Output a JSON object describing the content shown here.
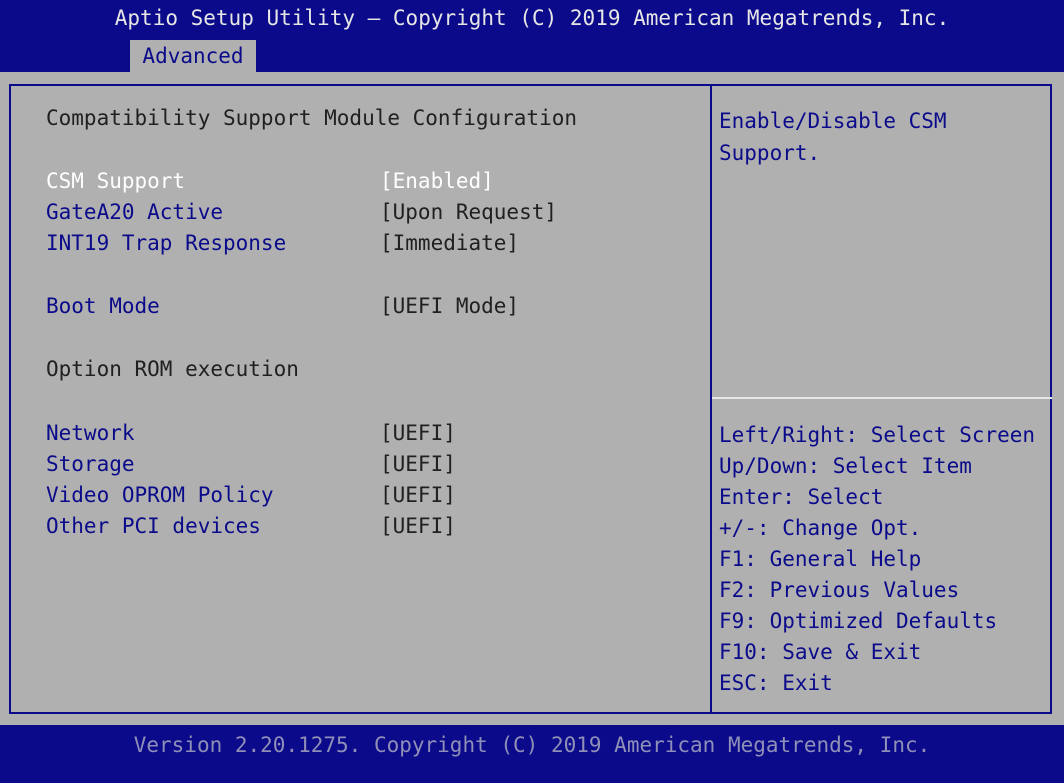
{
  "header": {
    "title": "Aptio Setup Utility – Copyright (C) 2019 American Megatrends, Inc.",
    "tab": "Advanced"
  },
  "main": {
    "heading": "Compatibility Support Module Configuration",
    "settings": [
      {
        "label": "CSM Support",
        "value": "[Enabled]"
      },
      {
        "label": "GateA20 Active",
        "value": "[Upon Request]"
      },
      {
        "label": "INT19 Trap Response",
        "value": "[Immediate]"
      },
      {
        "label": "Boot Mode",
        "value": "[UEFI Mode]"
      }
    ],
    "option_rom_heading": "Option ROM execution",
    "option_rom": [
      {
        "label": "Network",
        "value": "[UEFI]"
      },
      {
        "label": "Storage",
        "value": "[UEFI]"
      },
      {
        "label": "Video OPROM Policy",
        "value": "[UEFI]"
      },
      {
        "label": "Other PCI devices",
        "value": "[UEFI]"
      }
    ]
  },
  "help": {
    "description": [
      "Enable/Disable CSM",
      "Support."
    ],
    "keys": [
      "Left/Right: Select Screen",
      "Up/Down: Select Item",
      "Enter: Select",
      "+/-: Change Opt.",
      "F1: General Help",
      "F2: Previous Values",
      "F9: Optimized Defaults",
      "F10: Save & Exit",
      "ESC: Exit"
    ]
  },
  "footer": {
    "version": "Version 2.20.1275. Copyright (C) 2019 American Megatrends, Inc."
  },
  "colors": {
    "bios_blue": "#0a0a8a",
    "panel_gray": "#b0b0b0",
    "selected_white": "#ffffff"
  }
}
